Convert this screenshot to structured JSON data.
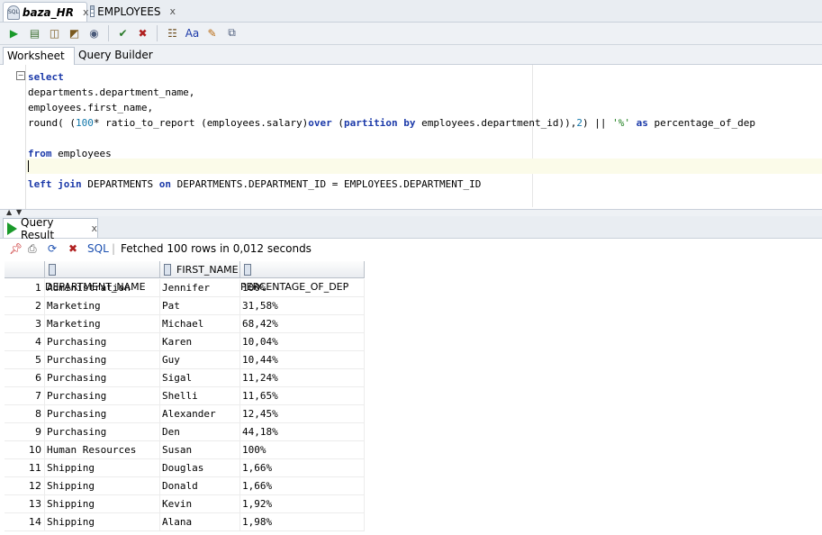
{
  "tabs": [
    {
      "label": "baza_HR",
      "icon": "sql-worksheet-icon",
      "active": true
    },
    {
      "label": "EMPLOYEES",
      "icon": "table-icon",
      "active": false
    }
  ],
  "toolbar": [
    {
      "name": "run-statement-button",
      "glyph": "▶",
      "color": "#1a9a2a"
    },
    {
      "name": "run-script-button",
      "glyph": "▤",
      "color": "#3b6e2f"
    },
    {
      "name": "explain-plan-button",
      "glyph": "◫",
      "color": "#7a5a1f"
    },
    {
      "name": "autotrace-button",
      "glyph": "◩",
      "color": "#7a5a1f"
    },
    {
      "name": "sql-tuning-advisor-button",
      "glyph": "◉",
      "color": "#4a5a7a"
    },
    {
      "name": "commit-button",
      "glyph": "✔",
      "color": "#2a7a2a"
    },
    {
      "name": "rollback-button",
      "glyph": "✖",
      "color": "#b02020"
    },
    {
      "name": "unshared-sql-button",
      "glyph": "☷",
      "color": "#6a4a1a"
    },
    {
      "name": "to-upper-lower-button",
      "glyph": "Aa",
      "color": "#1c3aa9"
    },
    {
      "name": "clear-button",
      "glyph": "✎",
      "color": "#b86a10"
    },
    {
      "name": "sql-history-button",
      "glyph": "⧉",
      "color": "#4a5a7a"
    }
  ],
  "subtabs": {
    "worksheet": "Worksheet",
    "query_builder": "Query Builder"
  },
  "editor": {
    "lines": [
      [
        {
          "t": "select",
          "c": "kw"
        }
      ],
      [
        {
          "t": "departments.department_name,",
          "c": ""
        }
      ],
      [
        {
          "t": "employees.first_name,",
          "c": ""
        }
      ],
      [
        {
          "t": "round( (",
          "c": ""
        },
        {
          "t": "100",
          "c": "num"
        },
        {
          "t": "* ratio_to_report (employees.salary)",
          "c": ""
        },
        {
          "t": "over",
          "c": "kw"
        },
        {
          "t": " (",
          "c": ""
        },
        {
          "t": "partition by",
          "c": "kw"
        },
        {
          "t": " employees.department_id)),",
          "c": ""
        },
        {
          "t": "2",
          "c": "num"
        },
        {
          "t": ") || ",
          "c": ""
        },
        {
          "t": "'%'",
          "c": "str"
        },
        {
          "t": " ",
          "c": ""
        },
        {
          "t": "as",
          "c": "kw"
        },
        {
          "t": " percentage_of_dep",
          "c": ""
        }
      ],
      [],
      [
        {
          "t": "from",
          "c": "kw"
        },
        {
          "t": " employees",
          "c": ""
        }
      ],
      [],
      [
        {
          "t": "left join",
          "c": "kw"
        },
        {
          "t": " DEPARTMENTS ",
          "c": ""
        },
        {
          "t": "on",
          "c": "kw"
        },
        {
          "t": " DEPARTMENTS.DEPARTMENT_ID = EMPLOYEES.DEPARTMENT_ID",
          "c": ""
        }
      ]
    ]
  },
  "result": {
    "tab_label": "Query Result",
    "sql_label": "SQL",
    "status": "Fetched 100 rows in 0,012 seconds",
    "columns": [
      "DEPARTMENT_NAME",
      "FIRST_NAME",
      "PERCENTAGE_OF_DEP"
    ],
    "rows": [
      [
        "1",
        "Administration",
        "Jennifer",
        "100%"
      ],
      [
        "2",
        "Marketing",
        "Pat",
        "31,58%"
      ],
      [
        "3",
        "Marketing",
        "Michael",
        "68,42%"
      ],
      [
        "4",
        "Purchasing",
        "Karen",
        "10,04%"
      ],
      [
        "5",
        "Purchasing",
        "Guy",
        "10,44%"
      ],
      [
        "6",
        "Purchasing",
        "Sigal",
        "11,24%"
      ],
      [
        "7",
        "Purchasing",
        "Shelli",
        "11,65%"
      ],
      [
        "8",
        "Purchasing",
        "Alexander",
        "12,45%"
      ],
      [
        "9",
        "Purchasing",
        "Den",
        "44,18%"
      ],
      [
        "10",
        "Human Resources",
        "Susan",
        "100%"
      ],
      [
        "11",
        "Shipping",
        "Douglas",
        "1,66%"
      ],
      [
        "12",
        "Shipping",
        "Donald",
        "1,66%"
      ],
      [
        "13",
        "Shipping",
        "Kevin",
        "1,92%"
      ],
      [
        "14",
        "Shipping",
        "Alana",
        "1,98%"
      ]
    ]
  }
}
